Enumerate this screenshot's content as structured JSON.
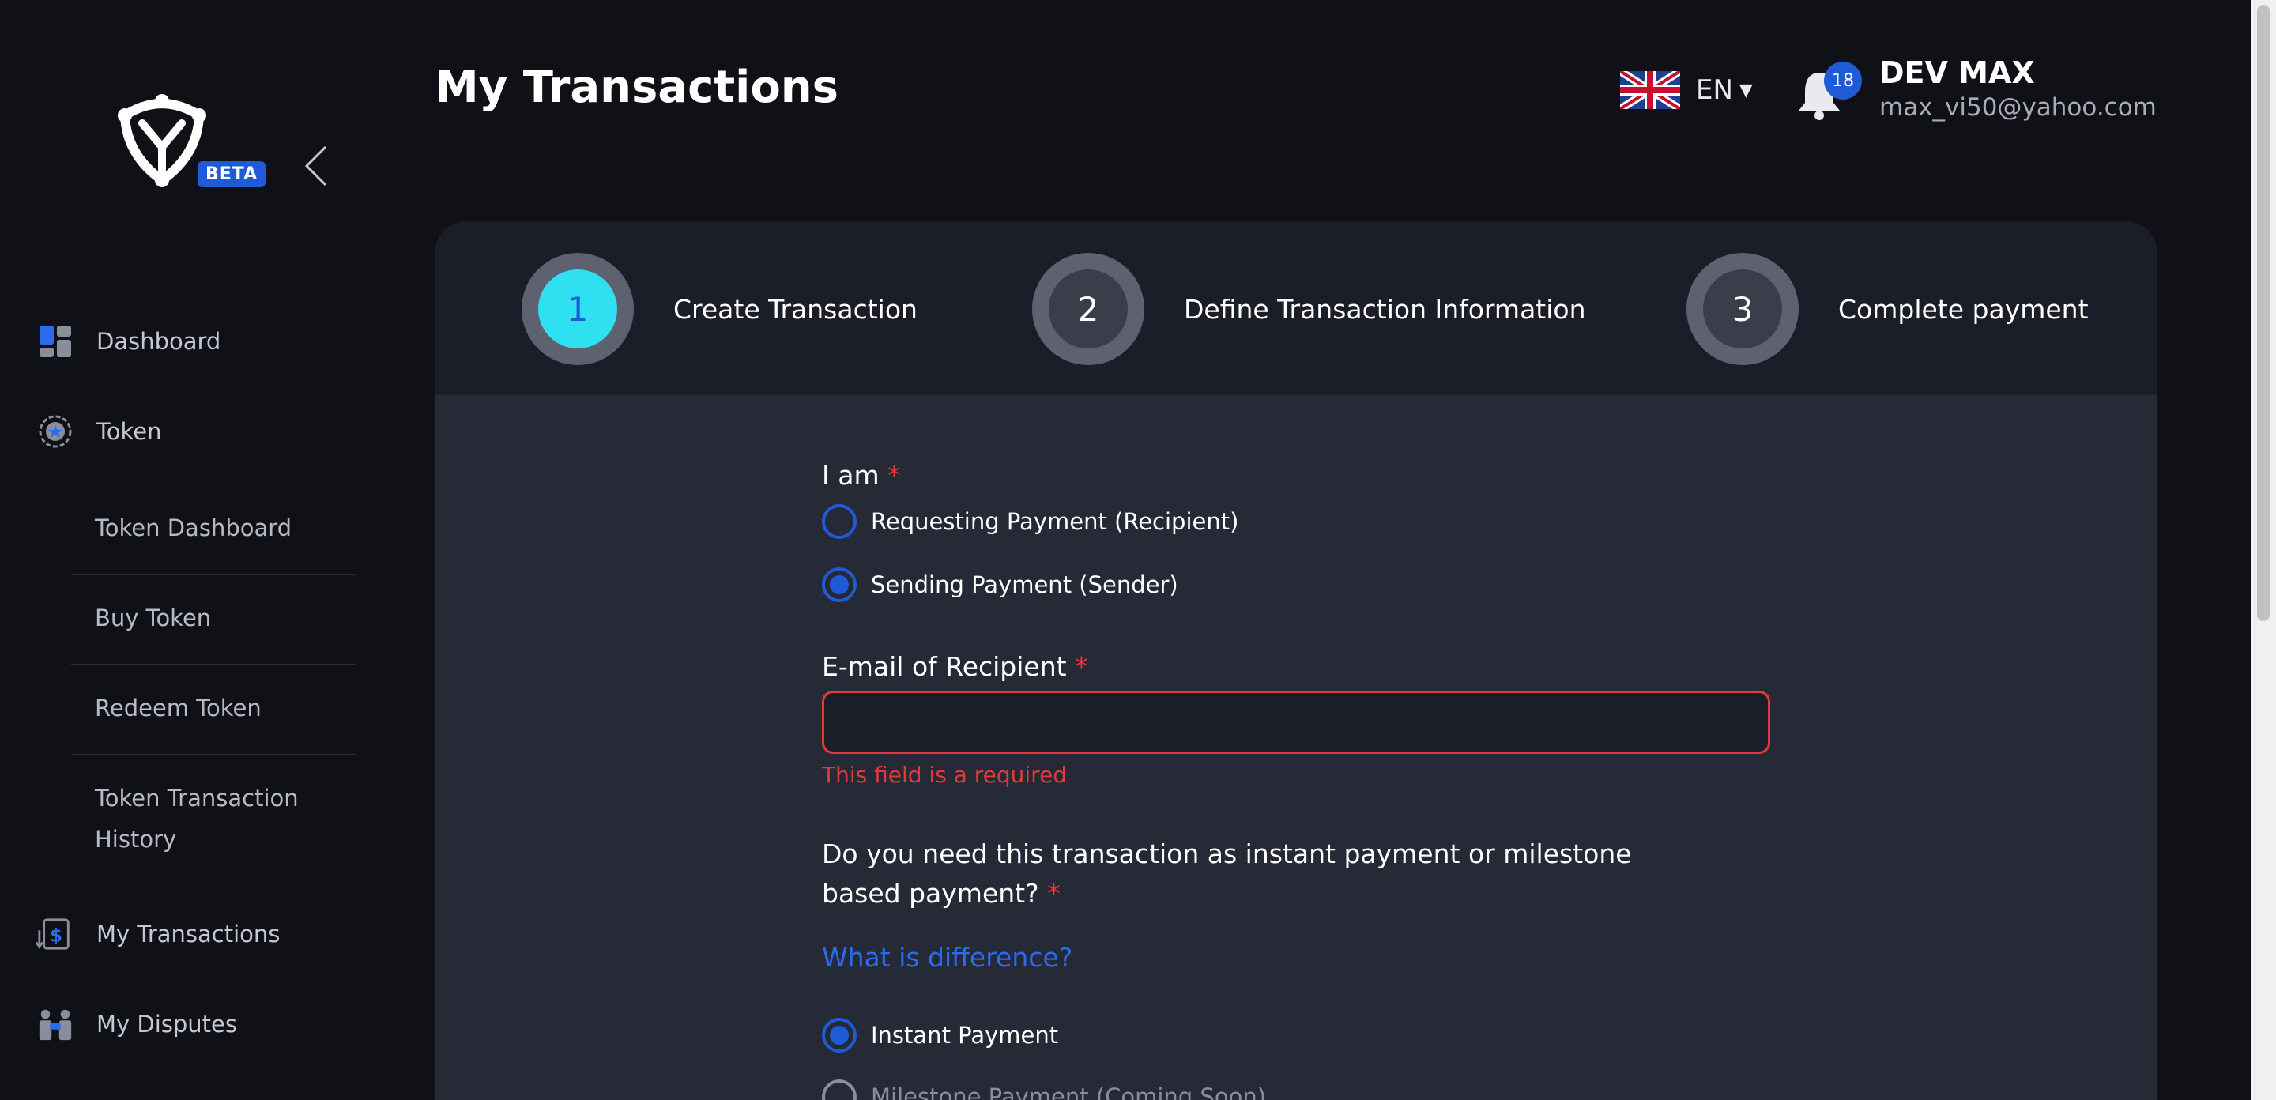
{
  "sidebar": {
    "beta_label": "BETA",
    "nav": {
      "dashboard": "Dashboard",
      "token": "Token",
      "token_sub": [
        "Token Dashboard",
        "Buy Token",
        "Redeem Token",
        "Token Transaction History"
      ],
      "my_transactions": "My Transactions",
      "my_disputes": "My Disputes"
    }
  },
  "header": {
    "title": "My Transactions",
    "language": "EN",
    "notification_count": "18",
    "user_name": "DEV MAX",
    "user_email": "max_vi50@yahoo.com"
  },
  "stepper": {
    "steps": [
      {
        "number": "1",
        "label": "Create Transaction",
        "active": true
      },
      {
        "number": "2",
        "label": "Define Transaction Information",
        "active": false
      },
      {
        "number": "3",
        "label": "Complete payment",
        "active": false
      }
    ]
  },
  "form": {
    "role_label": "I am",
    "required_mark": "*",
    "role_options": [
      {
        "label": "Requesting Payment (Recipient)",
        "selected": false
      },
      {
        "label": "Sending Payment (Sender)",
        "selected": true
      }
    ],
    "email_label": "E-mail of Recipient",
    "email_value": "",
    "email_error": "This field is a required",
    "payment_question": "Do you need this transaction as instant payment or milestone based payment?",
    "difference_link": "What is difference?",
    "payment_options": [
      {
        "label": "Instant Payment",
        "selected": true
      },
      {
        "label": "Milestone Payment (Coming Soon)",
        "selected": false,
        "disabled": true
      }
    ]
  },
  "colors": {
    "accent": "#1f5bd6",
    "active_step": "#2fe0f0",
    "error": "#e23a3a",
    "link": "#2a6cf0"
  }
}
